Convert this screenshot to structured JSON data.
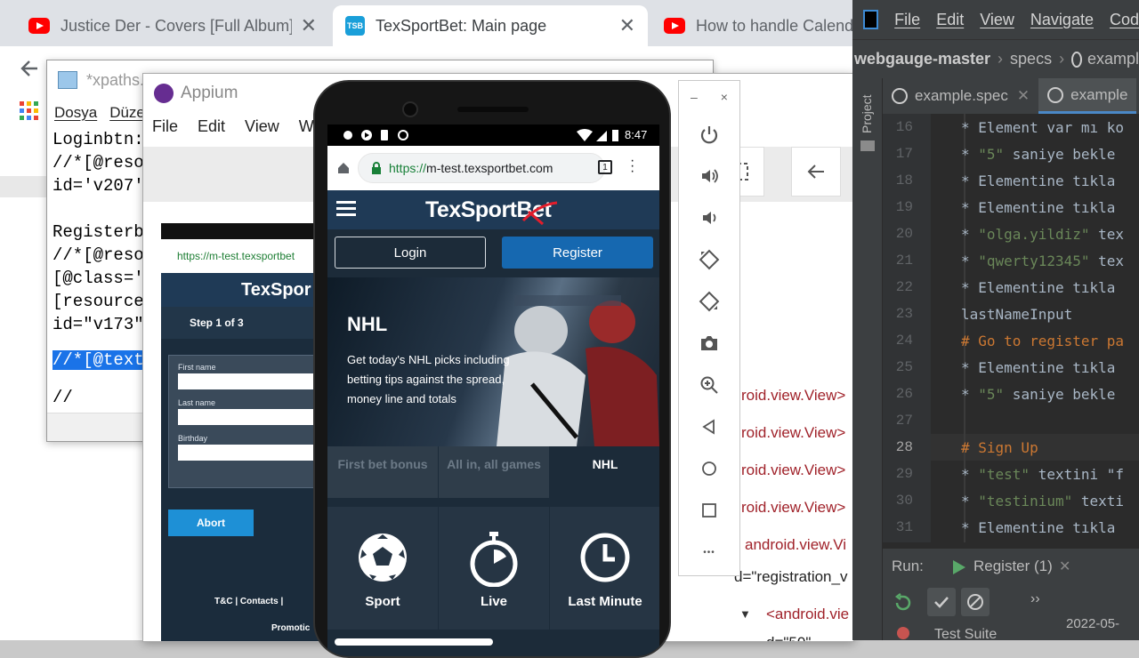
{
  "chrome": {
    "tabs": [
      {
        "title": "Justice Der - Covers [Full Album]",
        "icon": "youtube-icon"
      },
      {
        "title": "TexSportBet: Main page",
        "icon": "tsb-favicon",
        "favicon_text": "TSB"
      },
      {
        "title": "How to handle Calend",
        "icon": "youtube-icon"
      }
    ],
    "close_glyph": "✕"
  },
  "notepad": {
    "title": "*xpaths.t",
    "menu": [
      "Dosya",
      "Düze"
    ],
    "lines": [
      "Loginbtn:",
      "//*[@reso",
      "id='v207'",
      "",
      "Registerb",
      "//*[@reso",
      "[@class='",
      "[resource",
      "id=\"v173\""
    ],
    "selected_line": "//*[@text",
    "last_line": "//"
  },
  "appium": {
    "title": "Appium",
    "menu": [
      "File",
      "Edit",
      "View",
      "Win"
    ],
    "xml_lines": [
      "roid.view.View>",
      "roid.view.View>",
      "roid.view.View>",
      "roid.view.View>",
      "android.view.Vi"
    ],
    "xml_attr_line": "d=\"registration_v",
    "xml_node": "<android.vie",
    "xml_tail": "d=\"50\"",
    "mini": {
      "url": "https://m-test.texsportbet",
      "brand": "TexSpor",
      "step": "Step 1 of 3",
      "labels": [
        "First name",
        "Last name",
        "Birthday"
      ],
      "abort": "Abort",
      "footer": "T&C  |  Contacts  |",
      "footer2": "Promotic"
    }
  },
  "phone": {
    "time": "8:47",
    "url_scheme": "https://",
    "url_host": "m-test.texsportbet.com",
    "tab_count": "1",
    "logo_main": "TexSport",
    "logo_accent": "Bet",
    "login": "Login",
    "register": "Register",
    "hero_title": "NHL",
    "hero_desc": "Get today's NHL picks including betting tips against the spread, money line and totals",
    "category_tabs": [
      "First bet bonus",
      "All in, all games",
      "NHL"
    ],
    "sports": [
      "Sport",
      "Live",
      "Last Minute"
    ],
    "colors": {
      "header": "#1f3a56",
      "register": "#1668b0",
      "page": "#1c2b39"
    }
  },
  "emulator_bar": {
    "minimize": "–",
    "close": "×",
    "buttons": [
      "power-icon",
      "volume-up-icon",
      "volume-down-icon",
      "rotate-left-icon",
      "rotate-right-icon",
      "camera-icon",
      "zoom-icon",
      "back-icon",
      "home-icon",
      "overview-icon",
      "more-icon"
    ],
    "more_glyph": "•••"
  },
  "ide": {
    "menu": [
      "File",
      "Edit",
      "View",
      "Navigate",
      "Cod"
    ],
    "breadcrumb": [
      "webgauge-master",
      "specs",
      "exampl"
    ],
    "project_label": "Project",
    "tabs": [
      "example.spec",
      "example"
    ],
    "line_numbers": [
      "16",
      "17",
      "18",
      "19",
      "20",
      "21",
      "22",
      "23",
      "24",
      "25",
      "26",
      "27",
      "28",
      "29",
      "30",
      "31"
    ],
    "current_line": "28",
    "code": [
      {
        "pre": "* Element var mı ko",
        "str": "",
        "post": ""
      },
      {
        "pre": "* ",
        "str": "\"5\"",
        "post": " saniye bekle"
      },
      {
        "pre": "* Elementine tıkla",
        "str": "",
        "post": ""
      },
      {
        "pre": "* Elementine tıkla",
        "str": "",
        "post": ""
      },
      {
        "pre": "* ",
        "str": "\"olga.yildiz\"",
        "post": " tex"
      },
      {
        "pre": "* ",
        "str": "\"qwerty12345\"",
        "post": " tex"
      },
      {
        "pre": "* Elementine tıkla",
        "str": "",
        "post": ""
      },
      {
        "pre": "lastNameInput",
        "str": "",
        "post": ""
      },
      {
        "comment": "# Go to register pa"
      },
      {
        "pre": "* Elementine tıkla",
        "str": "",
        "post": ""
      },
      {
        "pre": "*  ",
        "str": "\"5\"",
        "post": " saniye bekle"
      },
      {
        "pre": "",
        "str": "",
        "post": ""
      },
      {
        "comment": "# Sign Up"
      },
      {
        "pre": "* ",
        "str": "\"test\"",
        "post": " textini \"f"
      },
      {
        "pre": "* ",
        "str": "\"testinium\"",
        "post": " texti"
      },
      {
        "pre": "* Elementine tıkla",
        "str": "",
        "post": ""
      }
    ],
    "run_label": "Run:",
    "run_config": "Register (1)",
    "test_suite": "Test Suite",
    "timestamp": "2022-05-",
    "more_glyph": "››"
  }
}
